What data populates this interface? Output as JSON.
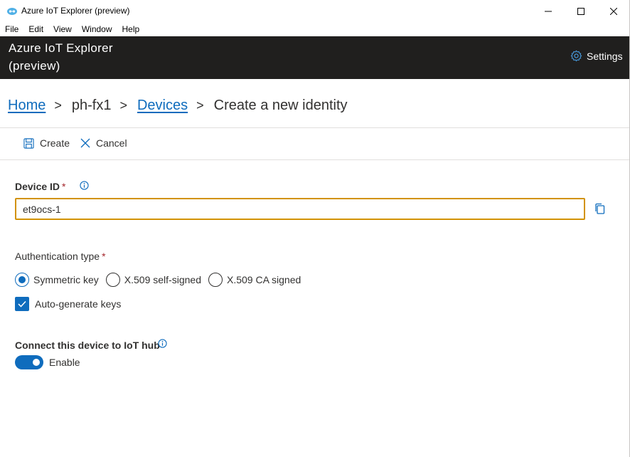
{
  "window": {
    "title": "Azure IoT Explorer (preview)",
    "controls": [
      "minimize",
      "maximize",
      "close"
    ]
  },
  "menu": {
    "items": [
      "File",
      "Edit",
      "View",
      "Window",
      "Help"
    ]
  },
  "header": {
    "title": "Azure IoT Explorer (preview)",
    "settings_label": "Settings",
    "background": "#201f1e"
  },
  "breadcrumb": {
    "items": [
      {
        "label": "Home",
        "link": true
      },
      {
        "label": "ph-fx1",
        "link": false
      },
      {
        "label": "Devices",
        "link": true
      },
      {
        "label": "Create a new identity",
        "link": false
      }
    ],
    "separator": ">"
  },
  "commands": {
    "create_label": "Create",
    "cancel_label": "Cancel"
  },
  "form": {
    "device_id": {
      "label": "Device ID",
      "required_mark": "*",
      "value": "et9ocs-1"
    },
    "auth": {
      "label": "Authentication type",
      "required_mark": "*",
      "options": [
        "Symmetric key",
        "X.509 self-signed",
        "X.509 CA signed"
      ],
      "selected": "Symmetric key"
    },
    "auto_generate": {
      "label": "Auto-generate keys",
      "checked": true
    },
    "connect": {
      "label": "Connect this device to IoT hub",
      "toggle_label": "Enable",
      "enabled": true
    }
  },
  "colors": {
    "accent": "#0f6cbd",
    "input_focus_border": "#d29200",
    "required": "#a4262c"
  },
  "icons": {
    "app": "iot-cloud-icon",
    "settings": "gear-icon",
    "create": "save-icon",
    "cancel": "close-icon",
    "info": "info-icon",
    "copy": "copy-icon"
  }
}
